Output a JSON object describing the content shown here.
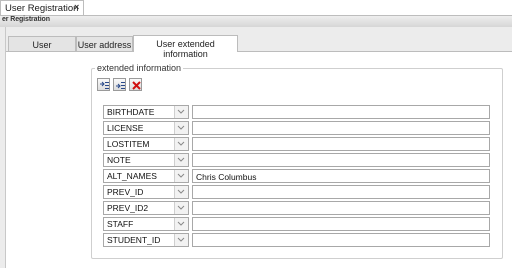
{
  "window": {
    "tab_label": "User Registration",
    "tab_close_glyph": "×",
    "title_strip": "er Registration"
  },
  "tabs": [
    {
      "label": "User information",
      "active": false
    },
    {
      "label": "User address",
      "active": false
    },
    {
      "label": "User extended information",
      "active": true
    }
  ],
  "group": {
    "legend": "extended information",
    "toolbar": [
      {
        "name": "add-row-icon"
      },
      {
        "name": "insert-row-icon"
      },
      {
        "name": "delete-row-icon"
      }
    ]
  },
  "rows": [
    {
      "key": "BIRTHDATE",
      "value": ""
    },
    {
      "key": "LICENSE",
      "value": ""
    },
    {
      "key": "LOSTITEM",
      "value": ""
    },
    {
      "key": "NOTE",
      "value": ""
    },
    {
      "key": "ALT_NAMES",
      "value": "Chris Columbus"
    },
    {
      "key": "PREV_ID",
      "value": ""
    },
    {
      "key": "PREV_ID2",
      "value": ""
    },
    {
      "key": "STAFF",
      "value": ""
    },
    {
      "key": "STUDENT_ID",
      "value": ""
    }
  ],
  "colors": {
    "delete_icon": "#d01010",
    "toolbar_icon": "#2a4a8a"
  }
}
